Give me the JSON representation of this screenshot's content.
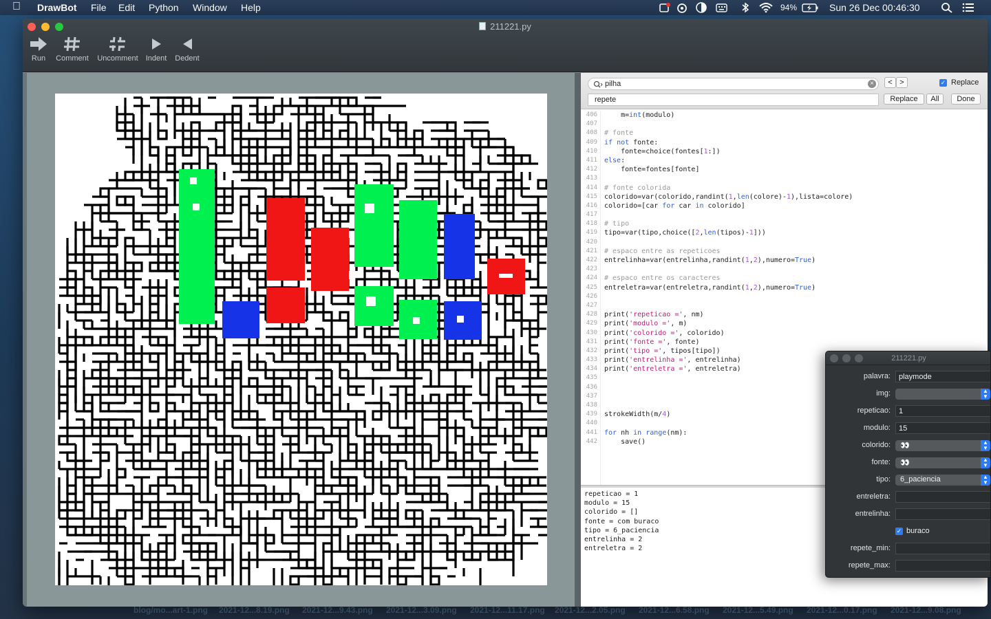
{
  "menubar": {
    "app_name": "DrawBot",
    "items": [
      "File",
      "Edit",
      "Python",
      "Window",
      "Help"
    ],
    "battery": "94%",
    "datetime": "Sun 26 Dec  00:46:30"
  },
  "window": {
    "title": "211221.py",
    "toolbar": [
      {
        "label": "Run",
        "icon": "run-arrow-icon"
      },
      {
        "label": "Comment",
        "icon": "hash-icon"
      },
      {
        "label": "Uncomment",
        "icon": "hash-broken-icon"
      },
      {
        "label": "Indent",
        "icon": "triangle-right-icon"
      },
      {
        "label": "Dedent",
        "icon": "triangle-left-icon"
      }
    ]
  },
  "canvas": {
    "colors": {
      "green": "#00f050",
      "red": "#f01616",
      "blue": "#1633e8",
      "ink": "#000000"
    }
  },
  "find": {
    "search_value": "pilha",
    "replace_value": "repete",
    "replace_label": "Replace",
    "replace_checked": true,
    "replace_button": "Replace",
    "all_button": "All",
    "done_button": "Done",
    "prev": "<",
    "next": ">"
  },
  "code_lines": [
    {
      "n": "406",
      "t": "    m=int(modulo)"
    },
    {
      "n": "407",
      "t": ""
    },
    {
      "n": "408",
      "t": "# fonte"
    },
    {
      "n": "409",
      "t": "if not fonte:"
    },
    {
      "n": "410",
      "t": "    fonte=choice(fontes[1:])"
    },
    {
      "n": "411",
      "t": "else:"
    },
    {
      "n": "412",
      "t": "    fonte=fontes[fonte]"
    },
    {
      "n": "413",
      "t": ""
    },
    {
      "n": "414",
      "t": "# fonte colorida"
    },
    {
      "n": "415",
      "t": "colorido=var(colorido,randint(1,len(colore)-1),lista=colore)"
    },
    {
      "n": "416",
      "t": "colorido=[car for car in colorido]"
    },
    {
      "n": "417",
      "t": ""
    },
    {
      "n": "418",
      "t": "# tipo"
    },
    {
      "n": "419",
      "t": "tipo=var(tipo,choice([2,len(tipos)-1]))"
    },
    {
      "n": "420",
      "t": ""
    },
    {
      "n": "421",
      "t": "# espaco entre as repeticoes"
    },
    {
      "n": "422",
      "t": "entrelinha=var(entrelinha,randint(1,2),numero=True)"
    },
    {
      "n": "423",
      "t": ""
    },
    {
      "n": "424",
      "t": "# espaco entre os caracteres"
    },
    {
      "n": "425",
      "t": "entreletra=var(entreletra,randint(1,2),numero=True)"
    },
    {
      "n": "426",
      "t": ""
    },
    {
      "n": "427",
      "t": ""
    },
    {
      "n": "428",
      "t": "print('repeticao =', nm)"
    },
    {
      "n": "429",
      "t": "print('modulo =', m)"
    },
    {
      "n": "430",
      "t": "print('colorido =', colorido)"
    },
    {
      "n": "431",
      "t": "print('fonte =', fonte)"
    },
    {
      "n": "432",
      "t": "print('tipo =', tipos[tipo])"
    },
    {
      "n": "433",
      "t": "print('entrelinha =', entrelinha)"
    },
    {
      "n": "434",
      "t": "print('entreletra =', entreletra)"
    },
    {
      "n": "435",
      "t": ""
    },
    {
      "n": "436",
      "t": ""
    },
    {
      "n": "437",
      "t": ""
    },
    {
      "n": "438",
      "t": ""
    },
    {
      "n": "439",
      "t": "strokeWidth(m/4)"
    },
    {
      "n": "440",
      "t": ""
    },
    {
      "n": "441",
      "t": "for nh in range(nm):"
    },
    {
      "n": "442",
      "t": "    save()"
    }
  ],
  "output_lines": [
    "repeticao = 1",
    "modulo = 15",
    "colorido = []",
    "fonte = com buraco",
    "tipo = 6_paciencia",
    "entrelinha = 2",
    "entreletra = 2"
  ],
  "vars_panel": {
    "title": "211221.py",
    "fields": [
      {
        "label": "palavra:",
        "kind": "text",
        "value": "playmode"
      },
      {
        "label": "img:",
        "kind": "select",
        "value": ""
      },
      {
        "label": "repeticao:",
        "kind": "text",
        "value": "1"
      },
      {
        "label": "modulo:",
        "kind": "text",
        "value": "15"
      },
      {
        "label": "colorido:",
        "kind": "select",
        "value": "👀"
      },
      {
        "label": "fonte:",
        "kind": "select",
        "value": "👀"
      },
      {
        "label": "tipo:",
        "kind": "select",
        "value": "6_paciencia"
      },
      {
        "label": "entreletra:",
        "kind": "text",
        "value": ""
      },
      {
        "label": "entrelinha:",
        "kind": "text",
        "value": ""
      },
      {
        "label": "buraco",
        "kind": "checkbox",
        "value": true
      },
      {
        "label": "repete_min:",
        "kind": "text",
        "value": ""
      },
      {
        "label": "repete_max:",
        "kind": "text",
        "value": ""
      }
    ]
  },
  "desktop_files": [
    "blog/mo...art-1.png",
    "2021-12...8.19.png",
    "2021-12...9.43.png",
    "2021-12...3.09.png",
    "2021-12...11.17.png",
    "2021-12...2.05.png",
    "2021-12...6.58.png",
    "2021-12...5.49.png",
    "2021-12...0.17.png",
    "2021-12...9.08.png"
  ]
}
